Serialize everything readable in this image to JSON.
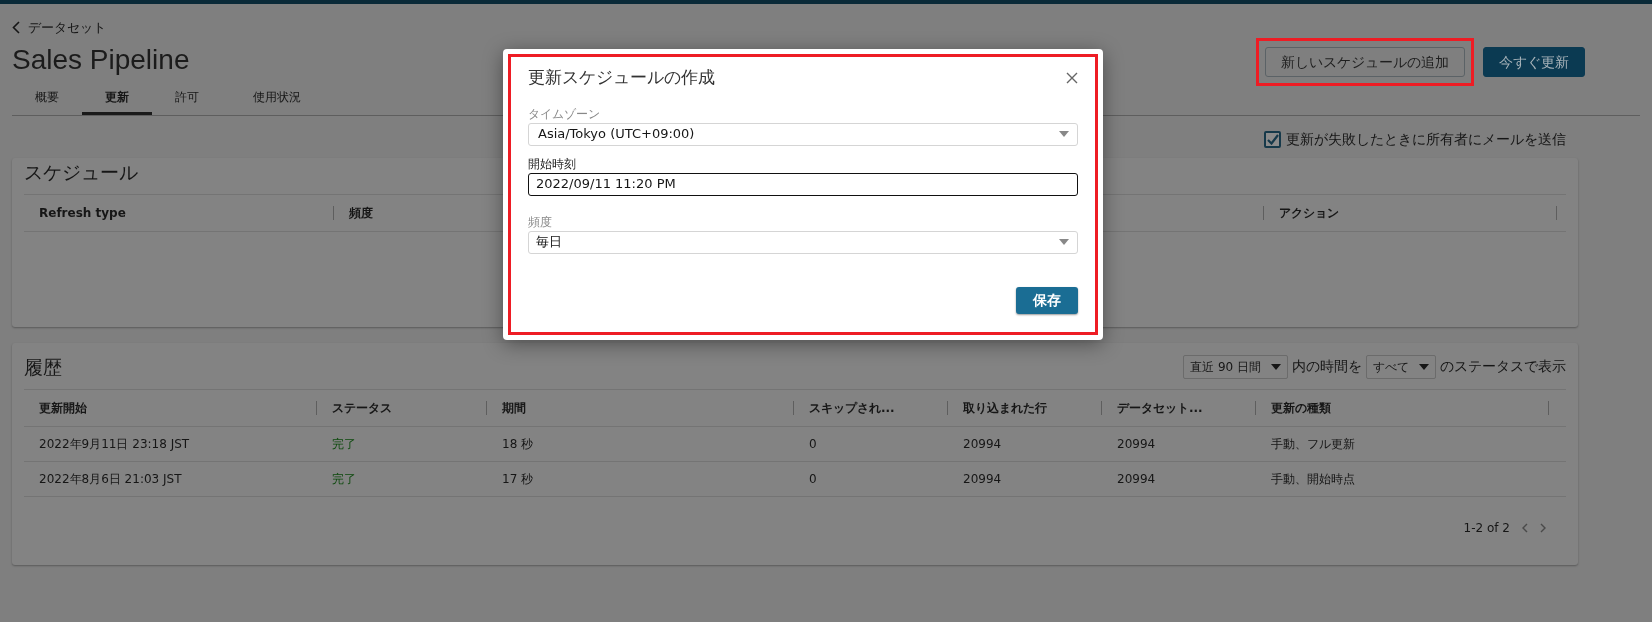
{
  "breadcrumb": {
    "label": "データセット"
  },
  "title": "Sales Pipeline",
  "tabs": [
    {
      "label": "概要",
      "selected": false
    },
    {
      "label": "更新",
      "selected": true
    },
    {
      "label": "許可",
      "selected": false
    },
    {
      "label": "使用状況",
      "selected": false
    }
  ],
  "header_buttons": [
    {
      "label": "新しいスケジュールの追加",
      "kind": "secondary",
      "highlighted": true
    },
    {
      "label": "今すぐ更新",
      "kind": "primary",
      "highlighted": false
    }
  ],
  "email_option": {
    "label": "更新が失敗したときに所有者にメールを送信",
    "checked": true
  },
  "schedule": {
    "title": "スケジュール",
    "columns": [
      "Refresh type",
      "頻度",
      "アクション"
    ]
  },
  "history": {
    "title": "履歴",
    "filter": {
      "period": "直近 90 日間",
      "text_1": "内の時間を",
      "status": "すべて",
      "text_2": "のステータスで表示"
    },
    "columns": [
      "更新開始",
      "ステータス",
      "期間",
      "スキップされ...",
      "取り込まれた行",
      "データセット...",
      "更新の種類"
    ],
    "rows": [
      [
        "2022年9月11日 23:18 JST",
        "完了",
        "18 秒",
        "0",
        "20994",
        "20994",
        "手動、フル更新"
      ],
      [
        "2022年8月6日 21:03 JST",
        "完了",
        "17 秒",
        "0",
        "20994",
        "20994",
        "手動、開始時点"
      ]
    ],
    "pagination": "1-2 of 2"
  },
  "dialog": {
    "title": "更新スケジュールの作成",
    "highlighted": true,
    "fields": [
      {
        "label": "タイムゾーン",
        "kind": "select",
        "value": "Asia/Tokyo (UTC+09:00)",
        "focused": false
      },
      {
        "label": "開始時刻",
        "kind": "text",
        "value": "2022/09/11 11:20 PM",
        "focused": true
      },
      {
        "label": "頻度",
        "kind": "select",
        "value": "毎日",
        "focused": false
      }
    ],
    "save_button": "保存"
  }
}
